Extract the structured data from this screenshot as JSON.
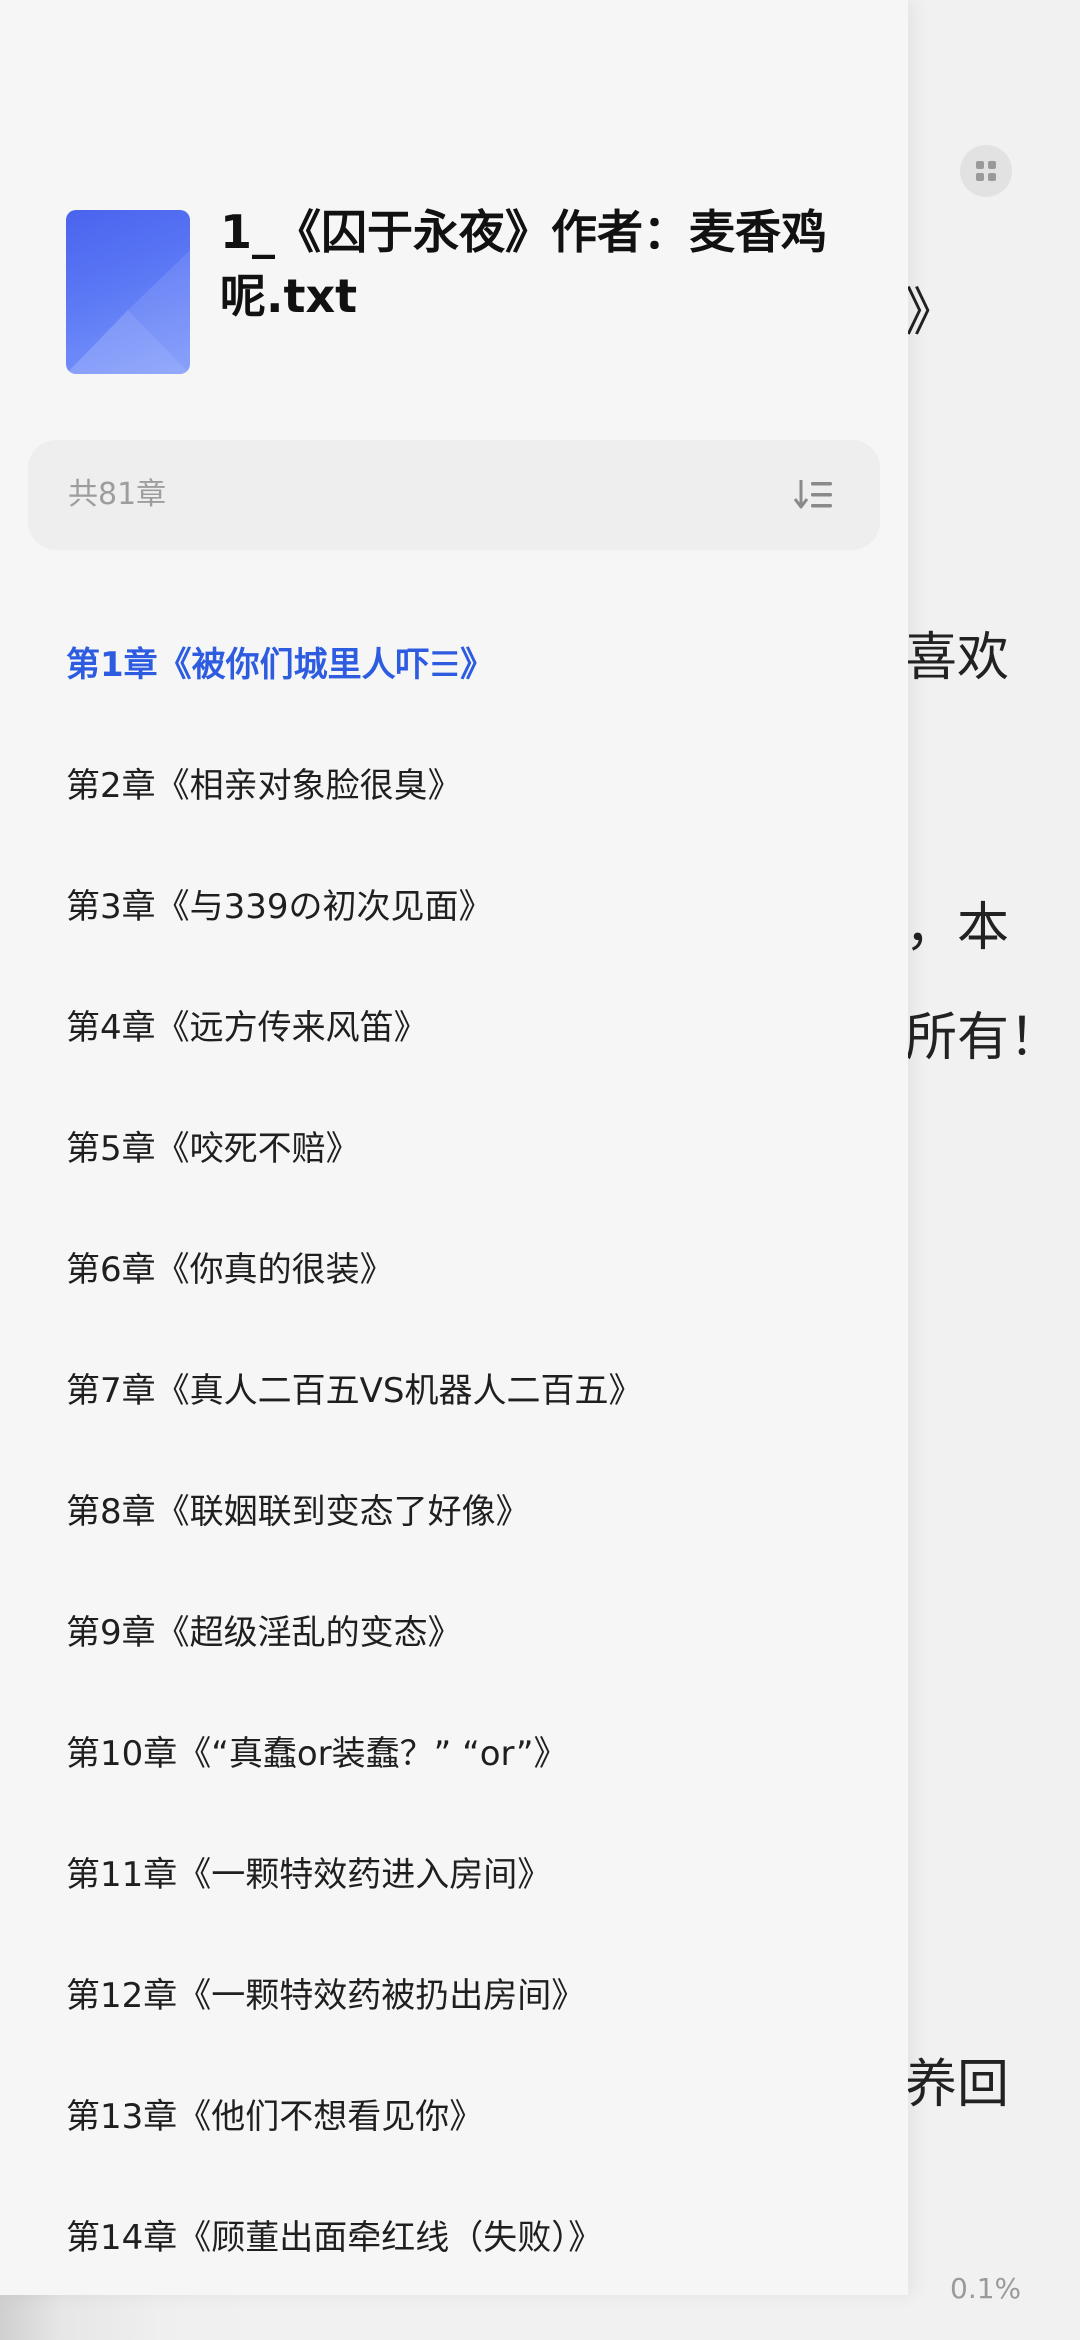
{
  "reader": {
    "visible_fragments": [
      "》",
      "喜欢",
      "，本",
      "所有！",
      "养回"
    ],
    "progress": "0.1%"
  },
  "drawer": {
    "book_title": "1_《囚于永夜》作者：麦香鸡呢.txt",
    "chapter_count": "共81章",
    "chapters": [
      {
        "label": "第1章《被你们城里人吓☰》",
        "active": true
      },
      {
        "label": "第2章《相亲对象脸很臭》",
        "active": false
      },
      {
        "label": "第3章《与339の初次见面》",
        "active": false
      },
      {
        "label": "第4章《远方传来风笛》",
        "active": false
      },
      {
        "label": "第5章《咬死不赔》",
        "active": false
      },
      {
        "label": "第6章《你真的很装》",
        "active": false
      },
      {
        "label": "第7章《真人二百五VS机器人二百五》",
        "active": false
      },
      {
        "label": "第8章《联姻联到变态了好像》",
        "active": false
      },
      {
        "label": "第9章《超级淫乱的变态》",
        "active": false
      },
      {
        "label": "第10章《“真蠢or装蠢？” “or”》",
        "active": false
      },
      {
        "label": "第11章《一颗特效药进入房间》",
        "active": false
      },
      {
        "label": "第12章《一颗特效药被扔出房间》",
        "active": false
      },
      {
        "label": "第13章《他们不想看见你》",
        "active": false
      },
      {
        "label": "第14章《顾董出面牵红线（失败）》",
        "active": false
      }
    ]
  },
  "colors": {
    "accent": "#2d5ce0",
    "drawer_bg": "#f6f6f6",
    "text": "#1f1f1f",
    "muted": "#9d9d9d"
  },
  "icons": {
    "reader_menu": "grid-icon",
    "sort": "sort-order-icon"
  }
}
